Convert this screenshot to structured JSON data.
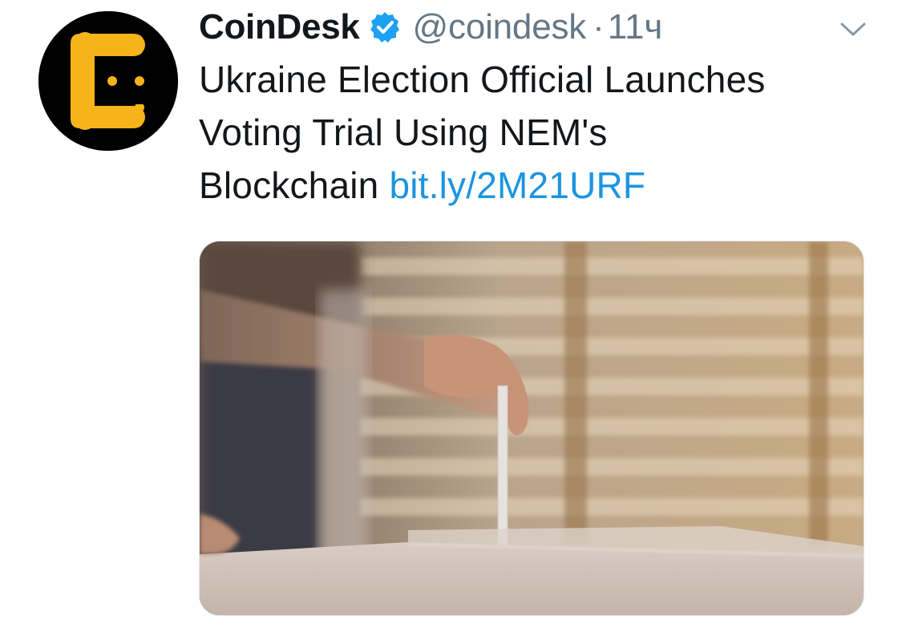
{
  "tweet": {
    "author": {
      "display_name": "CoinDesk",
      "handle": "@coindesk",
      "verified": true,
      "avatar_icon": "coindesk-logo-icon"
    },
    "separator": "·",
    "timestamp": "11ч",
    "text_lines": [
      "Ukraine Election Official Launches",
      "Voting Trial Using NEM's",
      "Blockchain"
    ],
    "link": "bit.ly/2M21URF",
    "media": {
      "description_icon": "ballot-box-photo"
    }
  },
  "colors": {
    "text": "#14171a",
    "secondary": "#657786",
    "link": "#1b95e0",
    "verified": "#1da1f2",
    "logo_yellow": "#f5b41a",
    "avatar_bg": "#000000"
  }
}
